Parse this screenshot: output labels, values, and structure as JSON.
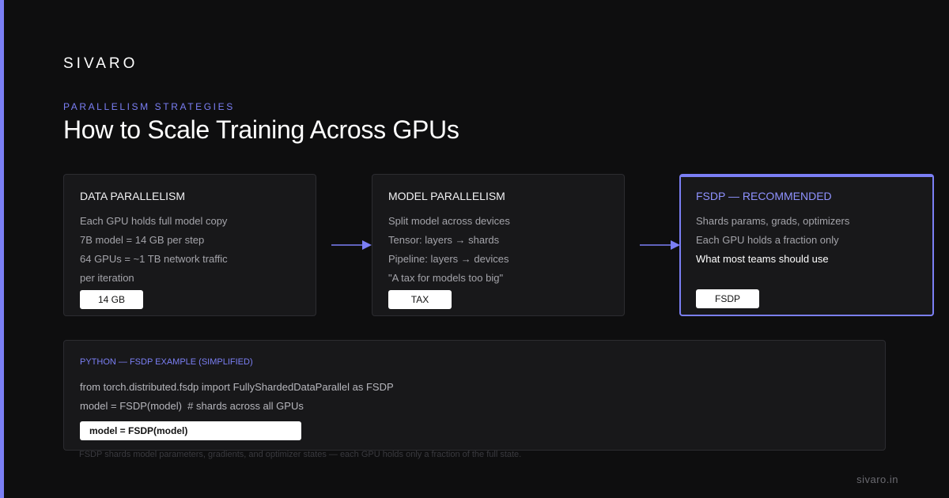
{
  "brand": {
    "logo": "SIVARO",
    "site": "sivaro.in",
    "accent_color": "#7b7ff5"
  },
  "header": {
    "eyebrow": "PARALLELISM STRATEGIES",
    "title": "How to Scale Training Across GPUs"
  },
  "cards": [
    {
      "title": "DATA PARALLELISM",
      "lines": [
        "Each GPU holds full model copy",
        "7B model = 14 GB per step",
        "64 GPUs = ~1 TB network traffic",
        "per iteration"
      ],
      "chip": "14 GB"
    },
    {
      "title": "MODEL PARALLELISM",
      "lines": [
        "Split model across devices",
        "Tensor: layers → shards",
        "Pipeline: layers → devices",
        "\"A tax for models too big\""
      ],
      "chip": "TAX"
    },
    {
      "title": "FSDP — RECOMMENDED",
      "lines": [
        "Shards params, grads, optimizers",
        "Each GPU holds a fraction only",
        "What most teams should use"
      ],
      "chip": "FSDP"
    }
  ],
  "code": {
    "label": "PYTHON — FSDP EXAMPLE (SIMPLIFIED)",
    "lines": [
      "from torch.distributed.fsdp import FullyShardedDataParallel as FSDP",
      "model = FSDP(model)  # shards across all GPUs"
    ],
    "highlight": "model = FSDP(model)"
  },
  "footnote": "FSDP shards model parameters, gradients, and optimizer states — each GPU holds only a fraction of the full state."
}
